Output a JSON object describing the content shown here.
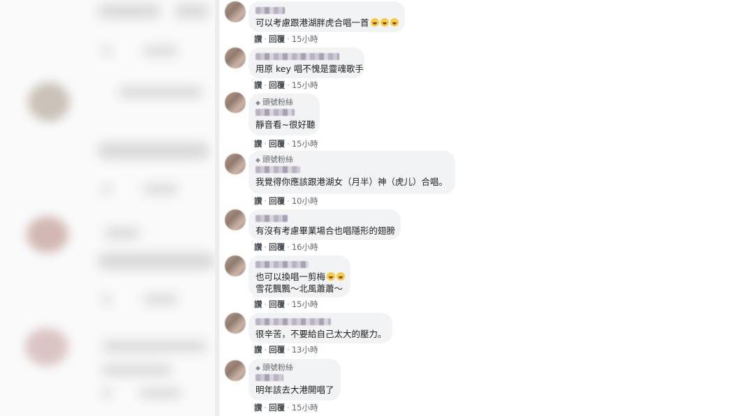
{
  "comments": [
    {
      "badge": "",
      "text_lines": [
        "可以考慮跟港湖胖虎合唱一首"
      ],
      "emoji_count": 3,
      "reply": "讚",
      "respond": "回覆",
      "time": "15小時"
    },
    {
      "badge": "",
      "text_lines": [
        "用原 key 唱不愧是靈魂歌手"
      ],
      "emoji_count": 0,
      "reply": "讚",
      "respond": "回覆",
      "time": "15小時"
    },
    {
      "badge": "頭號粉絲",
      "text_lines": [
        "靜音看~很好聽"
      ],
      "emoji_count": 0,
      "reply": "讚",
      "respond": "回覆",
      "time": "15小時"
    },
    {
      "badge": "頭號粉絲",
      "text_lines": [
        "我覺得你應該跟港湖女（月半）神（虎儿）合唱。"
      ],
      "emoji_count": 0,
      "reply": "讚",
      "respond": "回覆",
      "time": "10小時"
    },
    {
      "badge": "",
      "text_lines": [
        "有沒有考慮畢業場合也唱隱形的翅膀"
      ],
      "emoji_count": 0,
      "reply": "讚",
      "respond": "回覆",
      "time": "16小時"
    },
    {
      "badge": "",
      "text_lines": [
        "也可以換唱一剪梅",
        "雪花飄飄～北風蕭蕭～"
      ],
      "emoji_count": 2,
      "reply": "讚",
      "respond": "回覆",
      "time": "15小時"
    },
    {
      "badge": "",
      "text_lines": [
        "很辛苦，不要給自己太大的壓力。"
      ],
      "emoji_count": 0,
      "reply": "讚",
      "respond": "回覆",
      "time": "13小時"
    },
    {
      "badge": "頭號粉絲",
      "text_lines": [
        "明年該去大港開唱了"
      ],
      "emoji_count": 0,
      "reply": "讚",
      "respond": "回覆",
      "time": "15小時"
    }
  ]
}
